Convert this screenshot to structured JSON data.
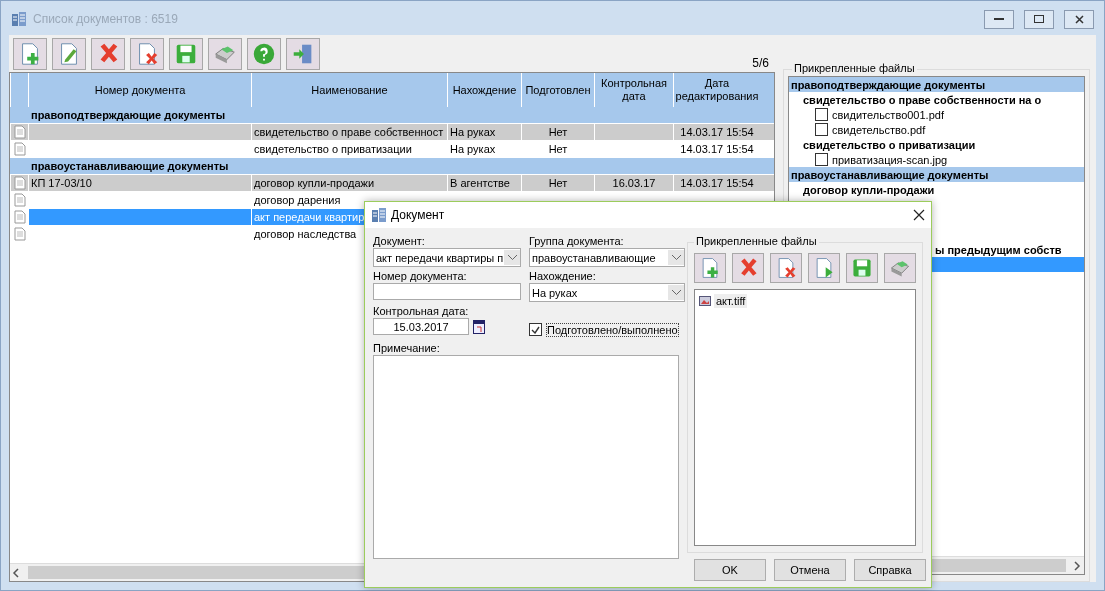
{
  "window": {
    "title": "Список документов : 6519"
  },
  "toolbar": [
    {
      "kind": "add"
    },
    {
      "kind": "edit"
    },
    {
      "kind": "delete"
    },
    {
      "kind": "delete-doc"
    },
    {
      "kind": "save"
    },
    {
      "kind": "print"
    },
    {
      "kind": "help"
    },
    {
      "kind": "exit"
    }
  ],
  "counter": "5/6",
  "table": {
    "columns": [
      "Номер документа",
      "Наименование",
      "Нахождение",
      "Подготовлен",
      "Контрольная дата",
      "Дата редактирования"
    ],
    "rows": [
      {
        "kind": "group",
        "title": "правоподтверждающие документы"
      },
      {
        "kind": "doc",
        "shaded": true,
        "selected": false,
        "cells": [
          "",
          "свидетельство о праве собственност",
          "На руках",
          "Нет",
          "",
          "14.03.17 15:54"
        ]
      },
      {
        "kind": "doc",
        "shaded": false,
        "selected": false,
        "cells": [
          "",
          "свидетельство о приватизации",
          "На руках",
          "Нет",
          "",
          "14.03.17 15:54"
        ]
      },
      {
        "kind": "group",
        "title": "правоустанавливающие документы"
      },
      {
        "kind": "doc",
        "shaded": true,
        "selected": false,
        "cells": [
          "КП 17-03/10",
          "договор купли-продажи",
          "В агентстве",
          "Нет",
          "16.03.17",
          "14.03.17 15:54"
        ]
      },
      {
        "kind": "doc",
        "shaded": false,
        "selected": false,
        "cells": [
          "",
          "договор дарения",
          "",
          "",
          "",
          ""
        ]
      },
      {
        "kind": "doc",
        "shaded": false,
        "selected": true,
        "cells": [
          "",
          "акт передачи квартир",
          "",
          "",
          "",
          ""
        ]
      },
      {
        "kind": "doc",
        "shaded": false,
        "selected": false,
        "cells": [
          "",
          "договор наследства",
          "",
          "",
          "",
          ""
        ]
      }
    ]
  },
  "attached": {
    "title": "Прикрепленные файлы",
    "tree": [
      {
        "kind": "group",
        "label": "правоподтверждающие документы",
        "selected": false,
        "children": [
          {
            "kind": "doc",
            "label": "свидетельство о праве собственности на о",
            "selected": false,
            "children": [
              {
                "kind": "file",
                "label": "свидительство001.pdf",
                "checked": false,
                "selected": false
              },
              {
                "kind": "file",
                "label": "свидетельство.pdf",
                "checked": false,
                "selected": false
              }
            ]
          },
          {
            "kind": "doc",
            "label": "свидетельство о приватизации",
            "selected": false,
            "children": [
              {
                "kind": "file",
                "label": "приватизация-scan.jpg",
                "checked": false,
                "selected": false
              }
            ]
          }
        ]
      },
      {
        "kind": "group",
        "label": "правоустанавливающие документы",
        "selected": false,
        "children": [
          {
            "kind": "doc",
            "label": "договор купли-продажи",
            "selected": false
          },
          {
            "kind": "doc",
            "selected": false
          },
          {
            "kind": "doc",
            "selected": false
          },
          {
            "kind": "doc",
            "selected": false
          },
          {
            "kind": "cut",
            "label": "ы предыдущим собств",
            "selected": false
          },
          {
            "kind": "doc",
            "selected": true
          }
        ]
      }
    ]
  },
  "dialog": {
    "title": "Документ",
    "document_label": "Документ:",
    "document_value": "акт передачи квартиры п",
    "group_label": "Группа документа:",
    "group_value": "правоустанавливающие",
    "number_label": "Номер документа:",
    "location_label": "Нахождение:",
    "location_value": "На руках",
    "date_label": "Контрольная дата:",
    "date_value": "15.03.2017",
    "done": {
      "label": "Подготовлено/выполнено",
      "checked": true
    },
    "note_label": "Примечание:",
    "files_title": "Прикрепленные файлы",
    "files_toolbar": [
      {
        "kind": "add"
      },
      {
        "kind": "delete"
      },
      {
        "kind": "delete-doc"
      },
      {
        "kind": "open"
      },
      {
        "kind": "save"
      },
      {
        "kind": "print"
      }
    ],
    "files": [
      {
        "name": "акт.tiff",
        "selected": false
      }
    ],
    "buttons": [
      "OK",
      "Отмена",
      "Справка"
    ]
  }
}
